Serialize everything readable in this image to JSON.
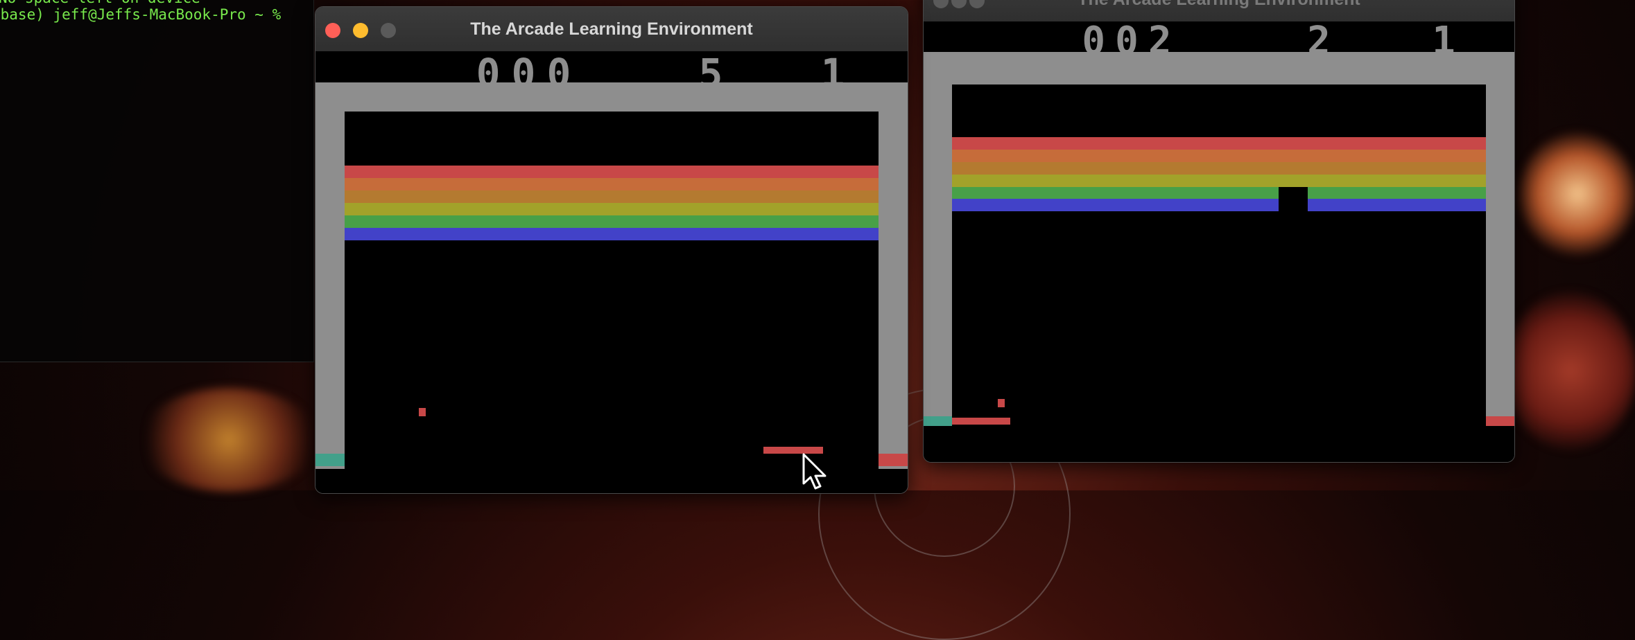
{
  "terminal": {
    "line1": "No space left on device",
    "line2": "(base) jeff@Jeffs-MacBook-Pro ~ %"
  },
  "window_active": {
    "title": "The Arcade Learning Environment",
    "score": "000",
    "lives": "5",
    "player": "1"
  },
  "window_inactive": {
    "title": "The Arcade Learning Environment",
    "score": "002",
    "lives": "2",
    "player": "1"
  },
  "colors": {
    "brick_rows": [
      "#c84848",
      "#c66c3a",
      "#b47a30",
      "#a2a22a",
      "#48a048",
      "#4242c8"
    ],
    "wall": "#8e8e8e",
    "paddle": "#c84848",
    "ball": "#c84848",
    "wall_base_left": "#42a08a",
    "wall_base_right": "#c84848"
  }
}
